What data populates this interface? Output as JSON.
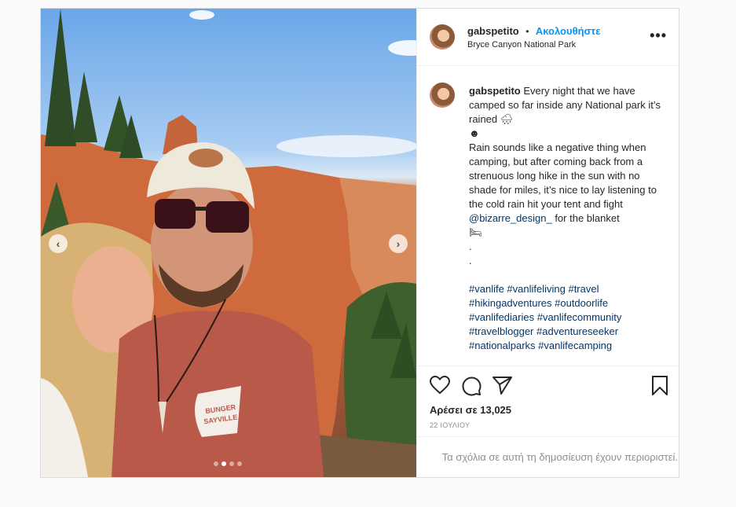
{
  "post": {
    "image_alt": "Selfie of a couple in front of a red rock arch",
    "cap_text": "BUNGER\nSAYVILLE",
    "carousel": {
      "count": 4,
      "active_index": 1
    }
  },
  "header": {
    "username": "gabspetito",
    "separator": "•",
    "follow_label": "Ακολουθήστε",
    "location": "Bryce Canyon National Park",
    "more_icon": "more-horizontal-icon"
  },
  "caption": {
    "username": "gabspetito",
    "text_1": " Every night that we have camped so far inside any National park it’s rained 🌧\n☻\nRain sounds like a negative thing when camping, but after coming back from a strenuous long hike in the sun with no shade for miles, it’s nice to lay listening to the cold rain hit your tent and fight ",
    "mention": "@bizarre_design_",
    "text_2": " for the blanket\n🛏\n.\n.\n\n",
    "hashtags": "#vanlife #vanlifeliving #travel #hikingadventures #outdoorlife #vanlifediaries #vanlifecommunity #travelblogger #adventureseeker #nationalparks #vanlifecamping"
  },
  "actions": {
    "like_icon": "heart-icon",
    "comment_icon": "comment-icon",
    "share_icon": "share-icon",
    "save_icon": "bookmark-icon",
    "likes_text": "Αρέσει σε 13,025",
    "date_text": "22 ΙΟΥΛΙΟΥ"
  },
  "comments": {
    "restricted_text": "Τα σχόλια σε αυτή τη δημοσίευση έχουν περιοριστεί."
  }
}
